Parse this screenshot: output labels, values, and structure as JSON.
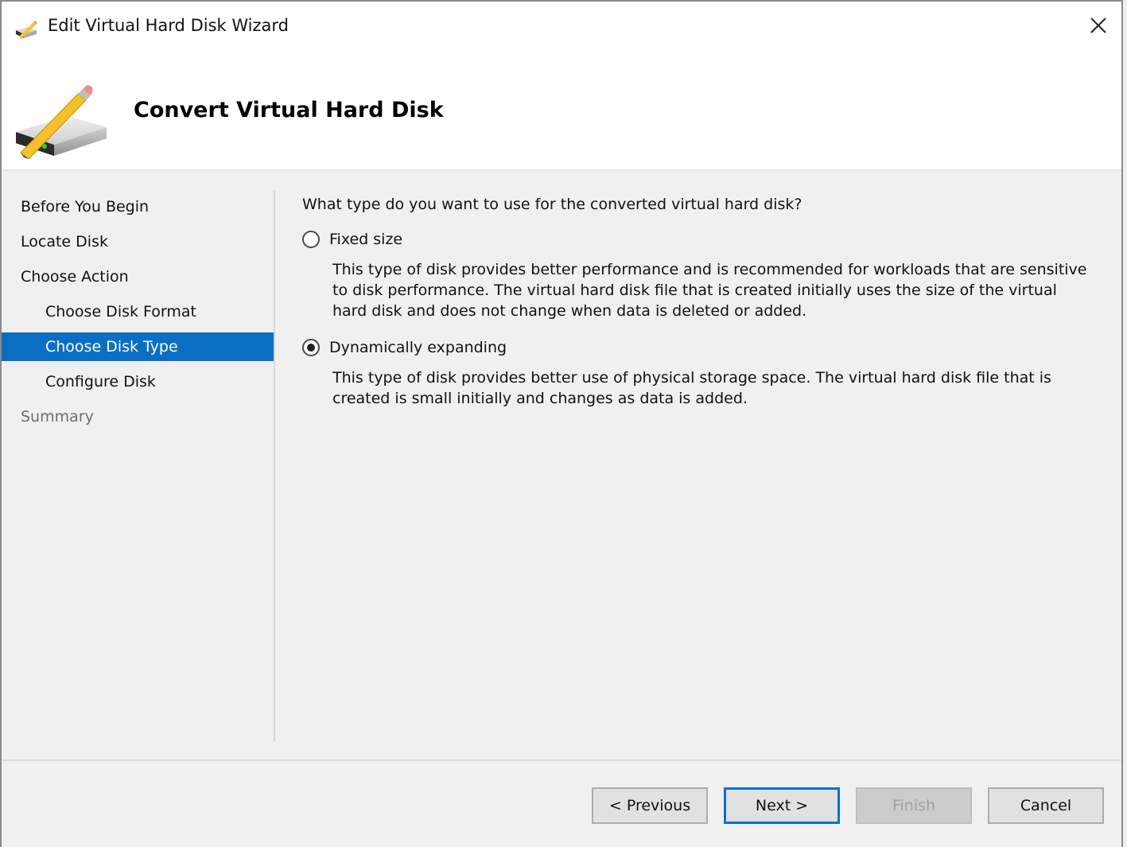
{
  "window": {
    "title": "Edit Virtual Hard Disk Wizard",
    "close_label": "✕"
  },
  "header": {
    "title": "Convert Virtual Hard Disk"
  },
  "nav": {
    "items": [
      {
        "label": "Before You Begin",
        "level": 0,
        "state": "normal"
      },
      {
        "label": "Locate Disk",
        "level": 0,
        "state": "normal"
      },
      {
        "label": "Choose Action",
        "level": 0,
        "state": "normal"
      },
      {
        "label": "Choose Disk Format",
        "level": 1,
        "state": "normal"
      },
      {
        "label": "Choose Disk Type",
        "level": 1,
        "state": "active"
      },
      {
        "label": "Configure Disk",
        "level": 1,
        "state": "normal"
      },
      {
        "label": "Summary",
        "level": 0,
        "state": "disabled"
      }
    ]
  },
  "content": {
    "question": "What type do you want to use for the converted virtual hard disk?",
    "options": [
      {
        "label": "Fixed size",
        "checked": false,
        "description": "This type of disk provides better performance and is recommended for workloads that are sensitive to disk performance. The virtual hard disk file that is created initially uses the size of the virtual hard disk and does not change when data is deleted or added."
      },
      {
        "label": "Dynamically expanding",
        "checked": true,
        "description": "This type of disk provides better use of physical storage space. The virtual hard disk file that is created is small initially and changes as data is added."
      }
    ]
  },
  "buttons": {
    "previous": "< Previous",
    "next": "Next >",
    "finish": "Finish",
    "cancel": "Cancel"
  },
  "colors": {
    "accent": "#0a6fc2",
    "default_button_border": "#0a6fd6"
  }
}
